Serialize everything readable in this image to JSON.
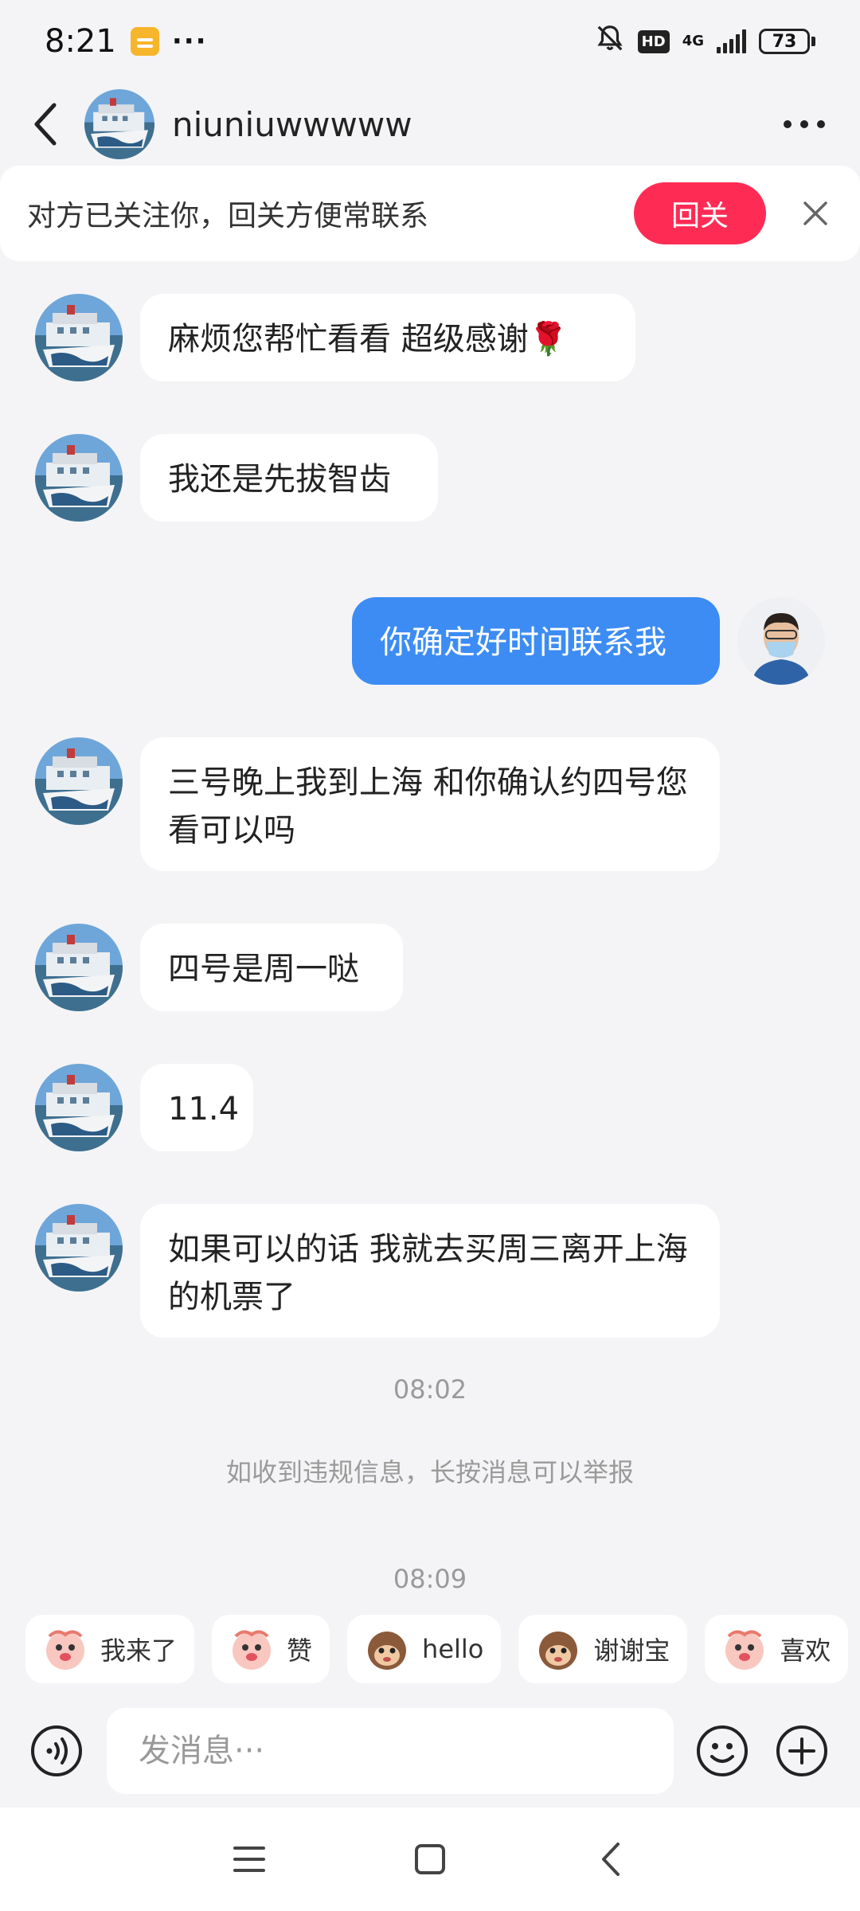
{
  "status_bar": {
    "time": "8:21",
    "more": "···",
    "hd": "HD",
    "network": "4G",
    "battery": "73"
  },
  "header": {
    "contact_name": "niuniuwwwww"
  },
  "banner": {
    "text": "对方已关注你，回关方便常联系",
    "follow_back": "回关"
  },
  "messages": [
    {
      "from": "them",
      "text": "麻烦您帮忙看看 超级感谢🌹"
    },
    {
      "from": "them",
      "text": "我还是先拔智齿"
    },
    {
      "from": "me",
      "text": "你确定好时间联系我"
    },
    {
      "from": "them",
      "text": "三号晚上我到上海 和你确认约四号您看可以吗"
    },
    {
      "from": "them",
      "text": "四号是周一哒"
    },
    {
      "from": "them",
      "text": "11.4"
    },
    {
      "from": "them",
      "text": "如果可以的话 我就去买周三离开上海的机票了"
    }
  ],
  "timestamps": [
    "08:02",
    "08:09"
  ],
  "report_notice": "如收到违规信息，长按消息可以举报",
  "quick_replies": [
    {
      "label": "我来了",
      "icon": "sticker-icon"
    },
    {
      "label": "赞",
      "icon": "sticker-icon"
    },
    {
      "label": "hello",
      "icon": "monkey-sticker-icon"
    },
    {
      "label": "谢谢宝",
      "icon": "sticker-icon"
    },
    {
      "label": "喜欢",
      "icon": "sticker-icon"
    }
  ],
  "composer": {
    "placeholder": "发消息···"
  },
  "colors": {
    "accent_blue": "#3c8cf4",
    "follow_red": "#fe2c55",
    "background": "#f4f4f6"
  }
}
